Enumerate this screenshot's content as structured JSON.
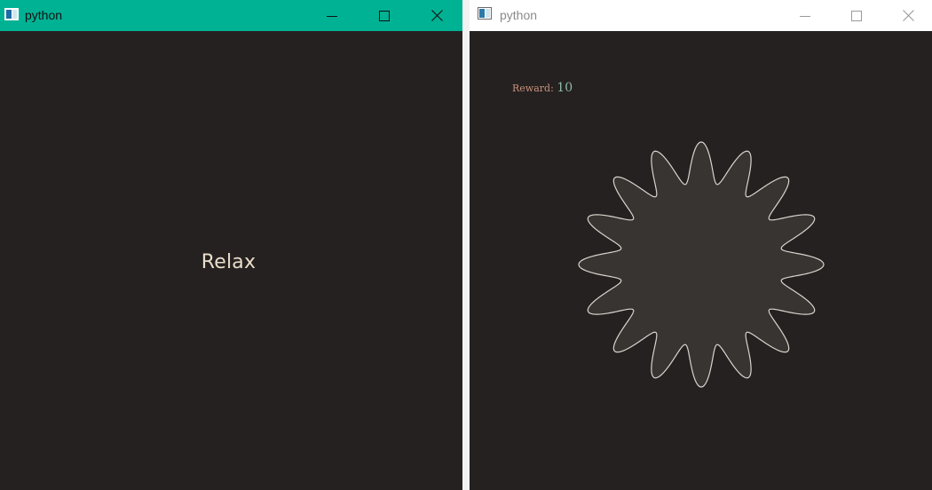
{
  "left_window": {
    "title": "python",
    "message": "Relax",
    "colors": {
      "titlebar": "#00b294",
      "background": "#252121",
      "text": "#e8ddc9"
    }
  },
  "right_window": {
    "title": "python",
    "reward": {
      "label": "Reward: ",
      "value": "10"
    },
    "shape": {
      "type": "wavy-star",
      "lobes": 16,
      "fill": "#383432",
      "stroke": "#d9d4cc"
    },
    "colors": {
      "titlebar": "#ffffff",
      "background": "#252121",
      "label": "#c7917a",
      "value": "#8fb9a6"
    }
  },
  "icons": [
    "window-icon",
    "minimize-icon",
    "maximize-icon",
    "close-icon"
  ]
}
